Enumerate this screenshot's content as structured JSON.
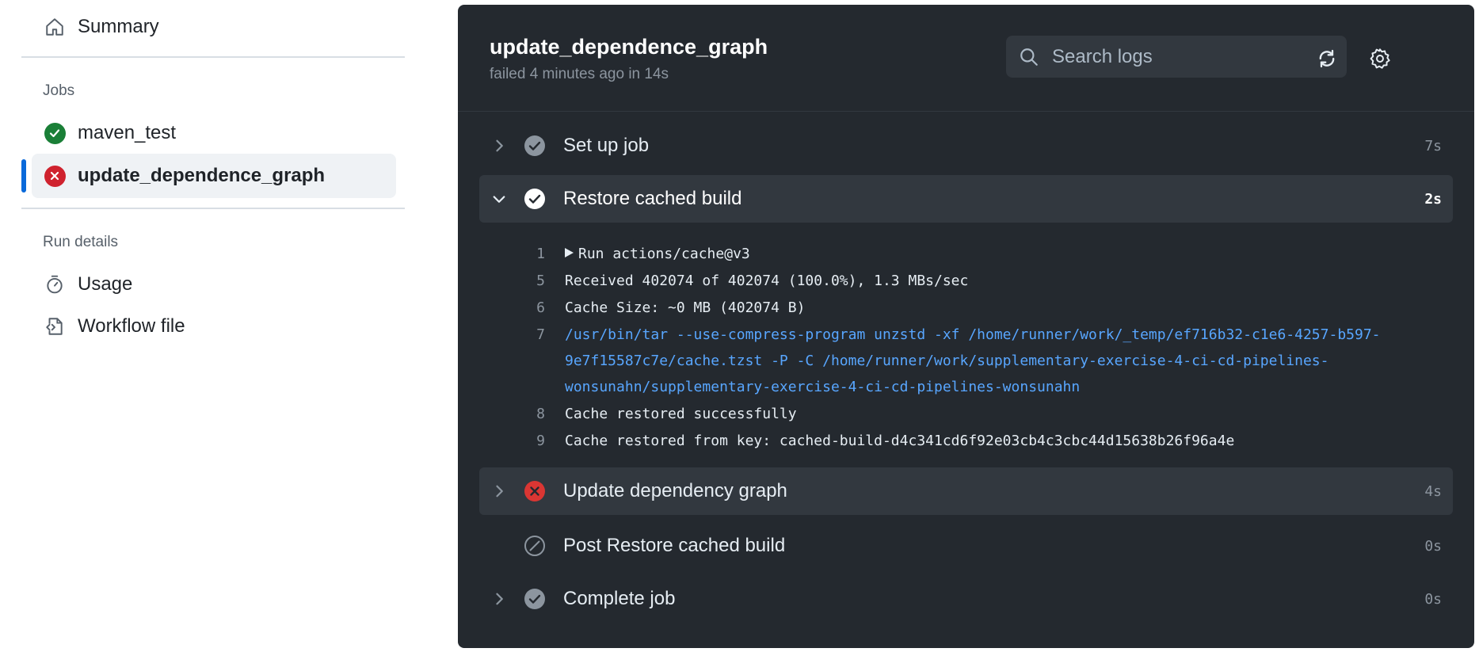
{
  "sidebar": {
    "summary_label": "Summary",
    "jobs_title": "Jobs",
    "jobs": [
      {
        "label": "maven_test",
        "status": "success"
      },
      {
        "label": "update_dependence_graph",
        "status": "failure"
      }
    ],
    "run_details_title": "Run details",
    "usage_label": "Usage",
    "workflow_file_label": "Workflow file"
  },
  "header": {
    "title": "update_dependence_graph",
    "subtitle": "failed 4 minutes ago in 14s",
    "search_placeholder": "Search logs"
  },
  "steps": [
    {
      "name": "Set up job",
      "duration": "7s",
      "status": "success",
      "expanded": false
    },
    {
      "name": "Restore cached build",
      "duration": "2s",
      "status": "success",
      "expanded": true
    },
    {
      "name": "Update dependency graph",
      "duration": "4s",
      "status": "failure",
      "expanded": false
    },
    {
      "name": "Post Restore cached build",
      "duration": "0s",
      "status": "skipped",
      "expanded": false
    },
    {
      "name": "Complete job",
      "duration": "0s",
      "status": "success",
      "expanded": false
    }
  ],
  "log_lines": [
    {
      "num": "1",
      "text": "Run actions/cache@v3"
    },
    {
      "num": "5",
      "text": "Received 402074 of 402074 (100.0%), 1.3 MBs/sec"
    },
    {
      "num": "6",
      "text": "Cache Size: ~0 MB (402074 B)"
    },
    {
      "num": "7",
      "text": "/usr/bin/tar --use-compress-program unzstd -xf /home/runner/work/_temp/ef716b32-c1e6-4257-b597-"
    },
    {
      "num": "",
      "text": "9e7f15587c7e/cache.tzst -P -C /home/runner/work/supplementary-exercise-4-ci-cd-pipelines-"
    },
    {
      "num": "",
      "text": "wonsunahn/supplementary-exercise-4-ci-cd-pipelines-wonsunahn"
    },
    {
      "num": "8",
      "text": "Cache restored successfully"
    },
    {
      "num": "9",
      "text": "Cache restored from key: cached-build-d4c341cd6f92e03cb4c3cbc44d15638b26f96a4e"
    }
  ],
  "colors": {
    "success": "#1a7f37",
    "failure": "#cf222e",
    "accent": "#0969da",
    "panel_bg": "#24292f",
    "command_text": "#58a6ff"
  }
}
